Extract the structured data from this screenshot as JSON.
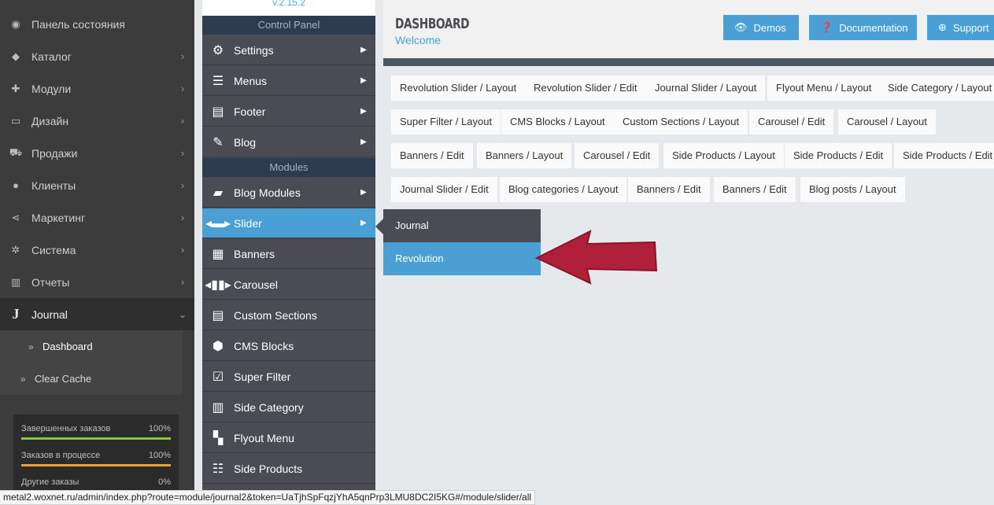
{
  "admin_sidebar": {
    "items": [
      {
        "label": "Панель состояния",
        "icon": "dashboard-icon"
      },
      {
        "label": "Каталог",
        "icon": "tag-icon"
      },
      {
        "label": "Модули",
        "icon": "puzzle-icon"
      },
      {
        "label": "Дизайн",
        "icon": "monitor-icon"
      },
      {
        "label": "Продажи",
        "icon": "cart-icon"
      },
      {
        "label": "Клиенты",
        "icon": "user-icon"
      },
      {
        "label": "Маркетинг",
        "icon": "share-icon"
      },
      {
        "label": "Система",
        "icon": "gear-icon"
      },
      {
        "label": "Отчеты",
        "icon": "bar-chart-icon"
      },
      {
        "label": "Journal",
        "icon": "journal-j-icon"
      }
    ],
    "journal_sub": [
      {
        "label": "Dashboard"
      },
      {
        "label": "Clear Cache"
      }
    ],
    "stats": [
      {
        "name": "Завершенных заказов",
        "percent": "100%",
        "color": "#8bc34a"
      },
      {
        "name": "Заказов в процессе",
        "percent": "100%",
        "color": "#f0a030"
      },
      {
        "name": "Другие заказы",
        "percent": "0%",
        "color": "#d9534f"
      }
    ]
  },
  "journal_menu": {
    "version": "v.2.15.2",
    "control_panel_header": "Control Panel",
    "modules_header": "Modules",
    "items": [
      {
        "label": "Settings",
        "icon": "gears-icon"
      },
      {
        "label": "Menus",
        "icon": "hamburger-icon"
      },
      {
        "label": "Footer",
        "icon": "footer-icon"
      },
      {
        "label": "Blog",
        "icon": "edit-icon"
      },
      {
        "label": "Blog Modules",
        "icon": "comment-icon"
      },
      {
        "label": "Slider",
        "icon": "slider-icon"
      },
      {
        "label": "Banners",
        "icon": "grid-icon"
      },
      {
        "label": "Carousel",
        "icon": "carousel-icon"
      },
      {
        "label": "Custom Sections",
        "icon": "sections-icon"
      },
      {
        "label": "CMS Blocks",
        "icon": "cube-icon"
      },
      {
        "label": "Super Filter",
        "icon": "checkbox-icon"
      },
      {
        "label": "Side Category",
        "icon": "side-category-icon"
      },
      {
        "label": "Flyout Menu",
        "icon": "flyout-icon"
      },
      {
        "label": "Side Products",
        "icon": "list-icon"
      }
    ]
  },
  "flyout": {
    "items": [
      {
        "label": "Journal"
      },
      {
        "label": "Revolution"
      }
    ]
  },
  "header": {
    "title": "DASHBOARD",
    "subtitle": "Welcome",
    "buttons": [
      {
        "label": "Demos",
        "icon": "eye-icon"
      },
      {
        "label": "Documentation",
        "icon": "question-icon"
      },
      {
        "label": "Support",
        "icon": "lifebuoy-icon"
      }
    ]
  },
  "shortcuts": [
    "Revolution Slider / Layout",
    "Revolution Slider / Edit",
    "Journal Slider / Layout",
    "Flyout Menu / Layout",
    "Side Category / Layout",
    "Super Filter / Layout",
    "CMS Blocks / Layout",
    "Custom Sections / Layout",
    "Carousel / Edit",
    "Carousel / Layout",
    "Banners / Edit",
    "Banners / Layout",
    "Carousel / Edit",
    "Side Products / Layout",
    "Side Products / Edit",
    "Side Products / Edit",
    "Journal Slider / Edit",
    "Blog categories / Layout",
    "Banners / Edit",
    "Banners / Edit",
    "Blog posts / Layout"
  ],
  "status_bar": {
    "url": "metal2.woxnet.ru/admin/index.php?route=module/journal2&token=UaTjhSpFqzjYhA5qnPrp3LMU8DC2I5KG#/module/slider/all"
  },
  "colors": {
    "accent": "#4aa0d5",
    "menu_bg": "#4a4b53",
    "annotation_arrow": "#b0203a"
  }
}
